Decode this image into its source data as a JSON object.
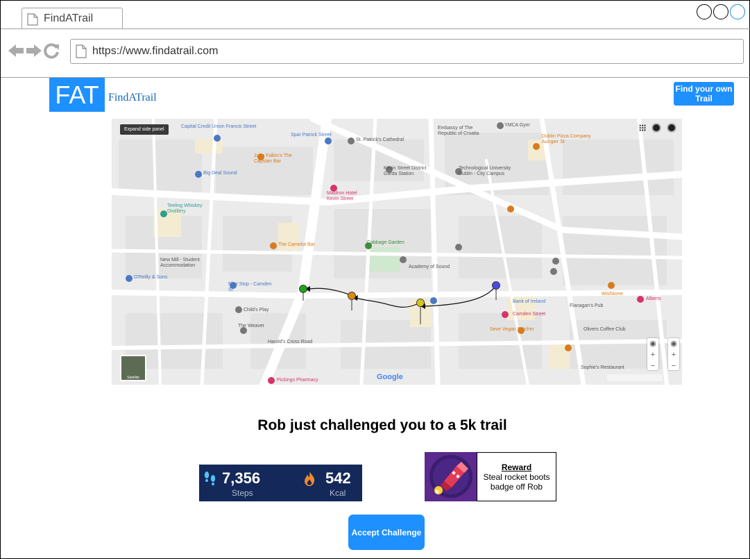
{
  "browser": {
    "tab_title": "FindATrail",
    "url": "https://www.findatrail.com"
  },
  "header": {
    "logo_mark": "FAT",
    "logo_text": "FindATrail",
    "cta_label": "Find your own Trail"
  },
  "map": {
    "expand_label": "Expand side panel",
    "satellite_label": "Satellite",
    "google_label": "Google",
    "places": [
      {
        "name": "Capital Credit Union Francis Street",
        "color": "#4a78c2"
      },
      {
        "name": "Spar Patrick Street",
        "color": "#4a78c2"
      },
      {
        "name": "St. Patrick's Cathedral",
        "color": "#555"
      },
      {
        "name": "Embassy of The Republic of Croatia",
        "color": "#555"
      },
      {
        "name": "YMCA Gym",
        "color": "#555"
      },
      {
        "name": "Dublin Pizza Company Aungier St",
        "color": "#d97b1b"
      },
      {
        "name": "John Fallon's The Capstan Bar",
        "color": "#d97b1b"
      },
      {
        "name": "Big Deal Sound",
        "color": "#4a78c2"
      },
      {
        "name": "Kevin Street District Garda Station",
        "color": "#555"
      },
      {
        "name": "Technological University Dublin - City Campus",
        "color": "#555"
      },
      {
        "name": "Maldron Hotel Kevin Street",
        "color": "#d6336c"
      },
      {
        "name": "Teeling Whiskey Distillery",
        "color": "#2e9e8f"
      },
      {
        "name": "Cabbage Garden",
        "color": "#3c8c3c"
      },
      {
        "name": "The Camelot Bar",
        "color": "#d97b1b"
      },
      {
        "name": "Academy of Sound",
        "color": "#555"
      },
      {
        "name": "New Mill - Student Accommodation",
        "color": "#555"
      },
      {
        "name": "O'Reilly & Sons",
        "color": "#4a78c2"
      },
      {
        "name": "First Stop - Camden St",
        "color": "#4a78c2"
      },
      {
        "name": "Child's Play",
        "color": "#555"
      },
      {
        "name": "The Weaver",
        "color": "#555"
      },
      {
        "name": "Bank of Ireland",
        "color": "#4a78c2"
      },
      {
        "name": "Camden Street",
        "color": "#d6336c"
      },
      {
        "name": "Seve Vegan Butcher",
        "color": "#d97b1b"
      },
      {
        "name": "Flanagan's Pub",
        "color": "#555"
      },
      {
        "name": "Wishbone",
        "color": "#d97b1b"
      },
      {
        "name": "Alberts",
        "color": "#d6336c"
      },
      {
        "name": "Olivers Coffee Club",
        "color": "#555"
      },
      {
        "name": "Harold's Cross Road",
        "color": "#555"
      },
      {
        "name": "Pickings Pharmacy",
        "color": "#d6336c"
      },
      {
        "name": "Sophie's Restaurant",
        "color": "#555"
      }
    ]
  },
  "challenge": {
    "headline": "Rob just challenged you to a 5k trail",
    "steps_value": "7,356",
    "steps_label": "Steps",
    "kcal_value": "542",
    "kcal_label": "Kcal",
    "reward_title": "Reward",
    "reward_text": "Steal rocket boots badge off Rob",
    "accept_label": "Accept Challenge"
  },
  "colors": {
    "brand_blue": "#1e90ff",
    "stats_bg": "#14285a",
    "reward_bg": "#5b2a8c"
  }
}
